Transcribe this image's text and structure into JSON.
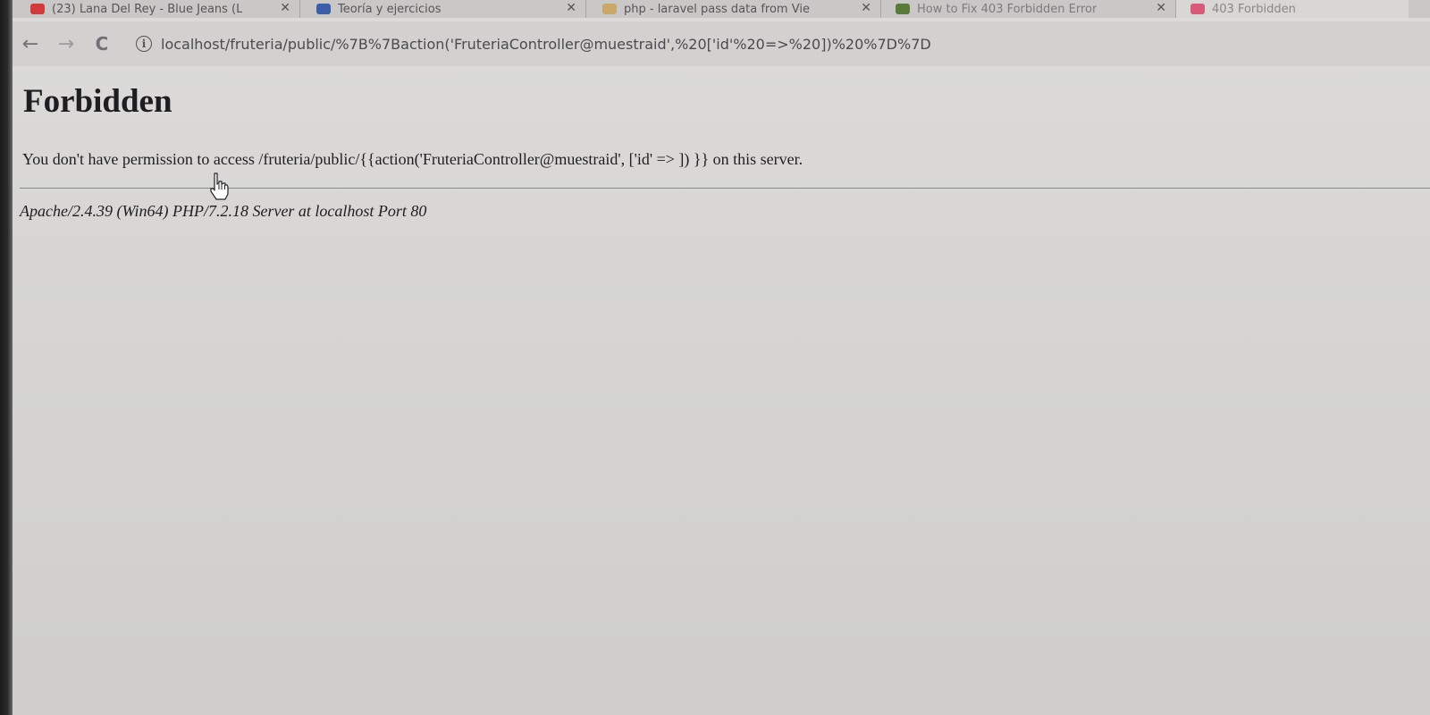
{
  "tabs": [
    {
      "title": "(23) Lana Del Rey - Blue Jeans (L",
      "favicon_color": "#d23b3b",
      "close": "✕"
    },
    {
      "title": "Teoría y ejercicios",
      "favicon_color": "#3a5fa8",
      "close": "✕"
    },
    {
      "title": "php - laravel pass data from Vie",
      "favicon_color": "#c9a86a",
      "close": "✕"
    },
    {
      "title": "How to Fix 403 Forbidden Error",
      "favicon_color": "#5a7a3a",
      "close": "✕"
    },
    {
      "title": "403 Forbidden",
      "favicon_color": "#d85a7a"
    }
  ],
  "toolbar": {
    "back_icon": "←",
    "forward_icon": "→",
    "reload_icon": "C",
    "info_icon": "i",
    "url": "localhost/fruteria/public/%7B%7Baction('FruteriaController@muestraid',%20['id'%20=>%20])%20%7D%7D"
  },
  "page": {
    "heading": "Forbidden",
    "message": "You don't have permission to access /fruteria/public/{{action('FruteriaController@muestraid', ['id' => ]) }} on this server.",
    "server_signature": "Apache/2.4.39 (Win64) PHP/7.2.18 Server at localhost Port 80"
  },
  "colors": {
    "background": "#d6d5d3",
    "text": "#1e1e22"
  }
}
